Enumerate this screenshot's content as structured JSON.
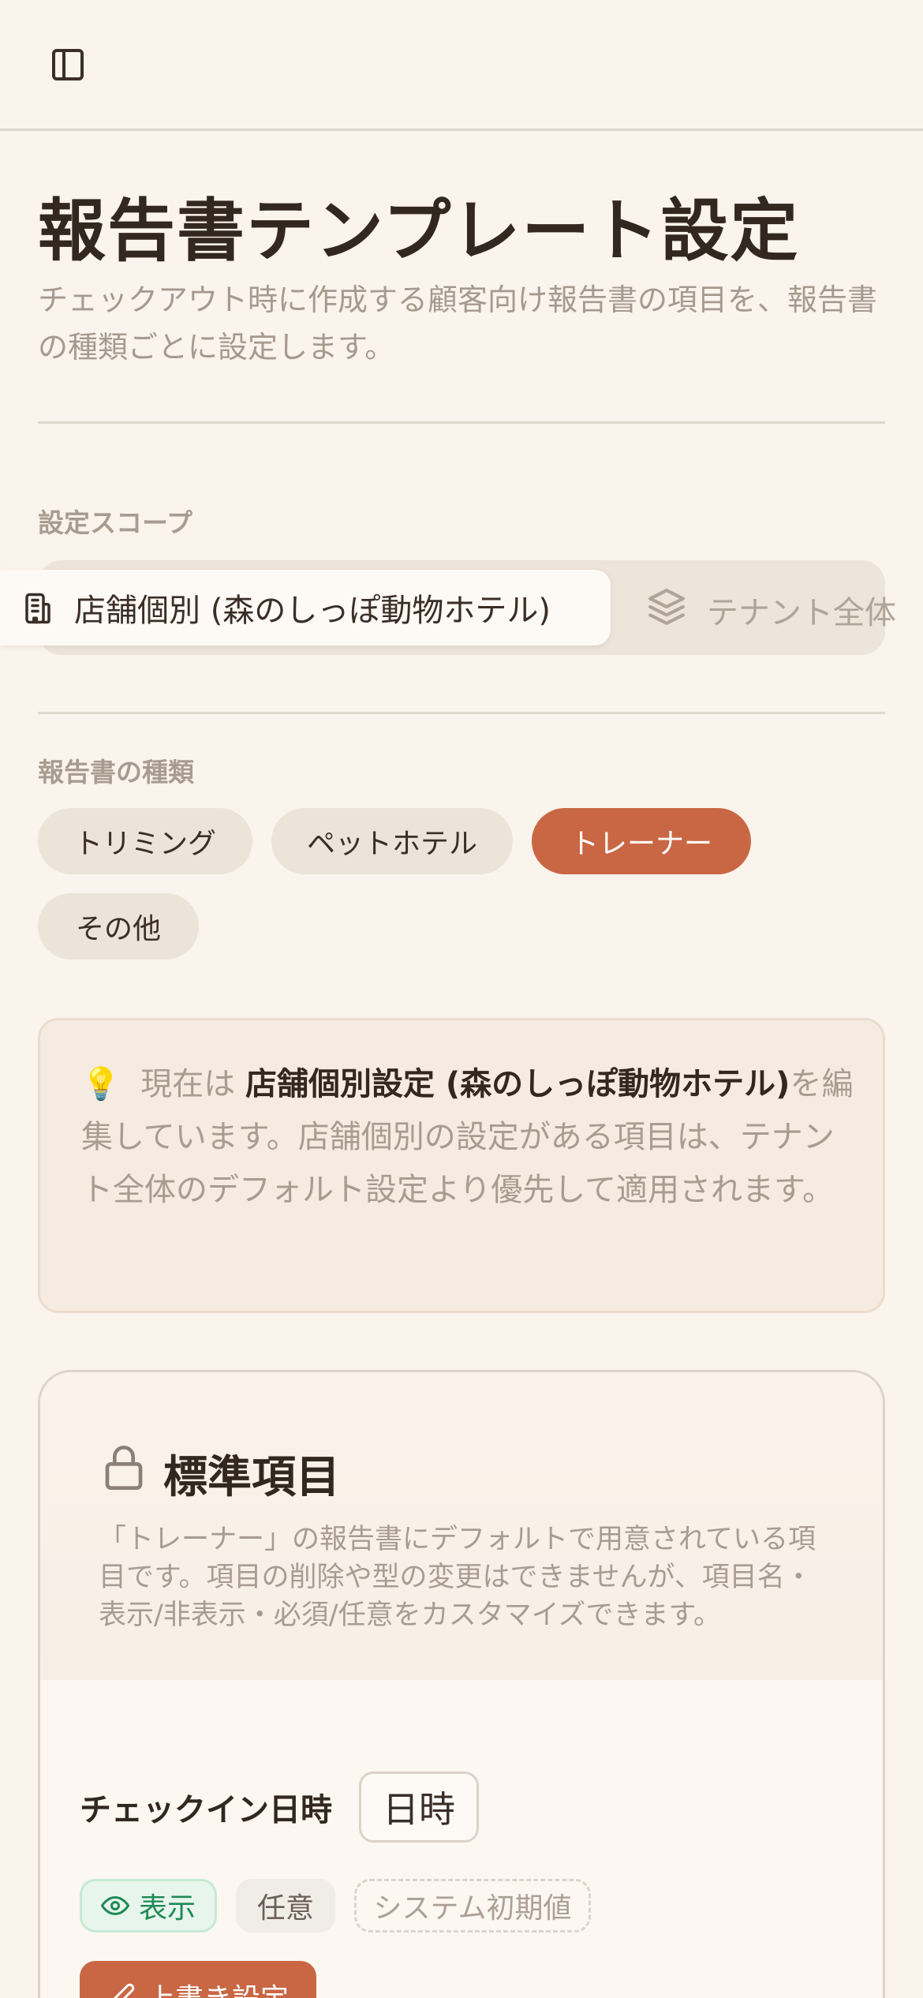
{
  "header": {
    "sidebar_toggle_icon": "sidebar-icon"
  },
  "page": {
    "title": "報告書テンプレート設定",
    "description": "チェックアウト時に作成する顧客向け報告書の項目を、報告書の種類ごとに設定します。"
  },
  "scope": {
    "label": "設定スコープ",
    "options": [
      {
        "label": "店舗個別 (森のしっぽ動物ホテル)",
        "icon": "building-icon",
        "selected": true
      },
      {
        "label": "テナント全体",
        "icon": "layers-icon",
        "selected": false
      }
    ]
  },
  "report_types": {
    "label": "報告書の種類",
    "options": [
      {
        "label": "トリミング",
        "selected": false
      },
      {
        "label": "ペットホテル",
        "selected": false
      },
      {
        "label": "トレーナー",
        "selected": true
      },
      {
        "label": "その他",
        "selected": false
      }
    ]
  },
  "notice": {
    "icon": "💡",
    "prefix": "現在は",
    "emphasis": "店舗個別設定 (森のしっぽ動物ホテル)",
    "suffix": "を編集しています。店舗個別の設定がある項目は、テナント全体のデフォルト設定より優先して適用されます。"
  },
  "standard_fields": {
    "title": "標準項目",
    "icon": "lock-icon",
    "description": "「トレーナー」の報告書にデフォルトで用意されている項目です。項目の削除や型の変更はできませんが、項目名・表示/非表示・必須/任意をカスタマイズできます。",
    "fields": [
      {
        "name": "チェックイン日時",
        "type": "日時",
        "visibility": "表示",
        "requirement": "任意",
        "source": "システム初期値",
        "override_label": "上書き設定"
      }
    ]
  },
  "colors": {
    "accent": "#c96745",
    "background": "#fbf4ec",
    "visible_green": "#1f8a55"
  }
}
